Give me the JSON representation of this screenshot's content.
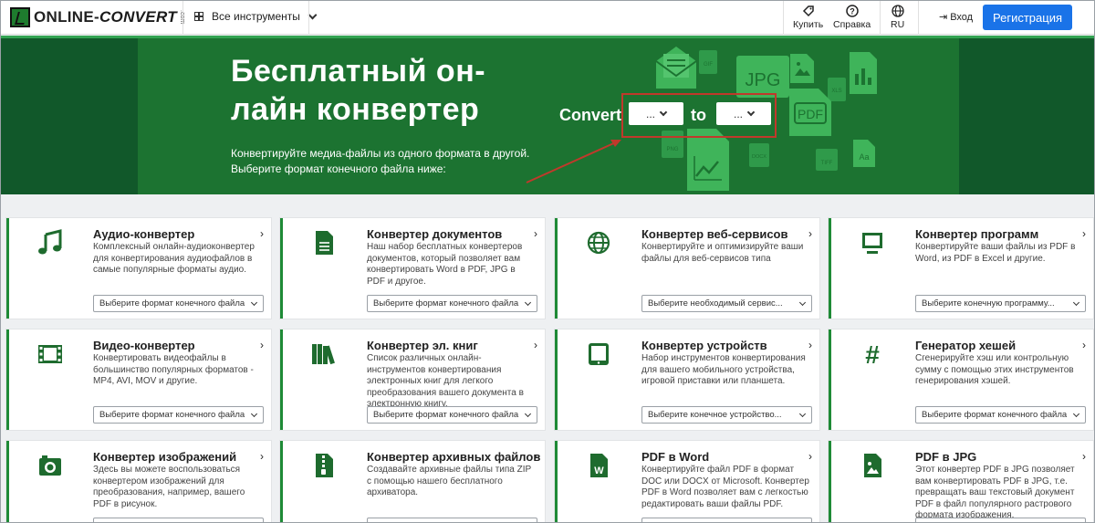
{
  "header": {
    "logo_main": "ONLINE-",
    "logo_conv": "CONVERT",
    "logo_com": ".com",
    "tools_label": "Все инструменты",
    "buy_label": "Купить",
    "help_label": "Справка",
    "lang_label": "RU",
    "login_label": "Вход",
    "register_label": "Регистрация",
    "accent_color": "#1a73e8"
  },
  "hero": {
    "title_line1": "Бесплатный он-",
    "title_line2": "лайн конвертер",
    "subtitle_line1": "Конвертируйте медиа-файлы из одного формата в другой.",
    "subtitle_line2": "Выберите формат конечного файла ниже:",
    "convert_label": "Convert",
    "to_label": "to",
    "from_value": "...",
    "to_value": "...",
    "deco_labels": [
      "JPG",
      "PDF",
      "GIF",
      "PNG",
      "XLS",
      "TIFF",
      "DOCX",
      "Aa"
    ],
    "bg_color": "#1c7331"
  },
  "cards": [
    {
      "title": "Аудио-конвертер",
      "desc": "Комплексный онлайн-аудиоконвертер для конвертирования аудиофайлов в самые популярные форматы аудио.",
      "select": "Выберите формат конечного файла",
      "icon": "music-note-icon"
    },
    {
      "title": "Конвертер документов",
      "desc": "Наш набор бесплатных конвертеров документов, который позволяет вам конвертировать Word в PDF, JPG в PDF и другое.",
      "select": "Выберите формат конечного файла",
      "icon": "document-icon"
    },
    {
      "title": "Конвертер веб-сервисов",
      "desc": "Конвертируйте и оптимизируйте ваши файлы для веб-сервисов типа",
      "select": "Выберите необходимый сервис...",
      "icon": "globe-icon"
    },
    {
      "title": "Конвертер программ",
      "desc": "Конвертируйте ваши файлы из PDF в Word, из PDF в Excel и другие.",
      "select": "Выберите конечную программу...",
      "icon": "monitor-icon"
    },
    {
      "title": "Видео-конвертер",
      "desc": "Конвертировать видеофайлы в большинство популярных форматов - MP4, AVI, MOV и другие.",
      "select": "Выберите формат конечного файла",
      "icon": "film-icon"
    },
    {
      "title": "Конвертер эл. книг",
      "desc": "Список различных онлайн-инструментов конвертирования электронных книг для легкого преобразования вашего документа в электронную книгу.",
      "select": "Выберите формат конечного файла",
      "icon": "books-icon"
    },
    {
      "title": "Конвертер устройств",
      "desc": "Набор инструментов конвертирования для вашего мобильного устройства, игровой приставки или планшета.",
      "select": "Выберите конечное устройство...",
      "icon": "tablet-icon"
    },
    {
      "title": "Генератор хешей",
      "desc": "Сгенерируйте хэш или контрольную сумму с помощью этих инструментов генерирования хэшей.",
      "select": "Выберите формат конечного файла",
      "icon": "hash-icon"
    },
    {
      "title": "Конвертер изображений",
      "desc": "Здесь вы можете воспользоваться конвертером изображений для преобразования, например, вашего PDF в рисунок.",
      "select": "",
      "icon": "camera-icon"
    },
    {
      "title": "Конвертер архивных файлов",
      "desc": "Создавайте архивные файлы типа ZIP с помощью нашего бесплатного архиватора.",
      "select": "",
      "icon": "archive-icon"
    },
    {
      "title": "PDF в Word",
      "desc": "Конвертируйте файл PDF в формат DOC или DOCX от Microsoft. Конвертер PDF в Word позволяет вам с легкостью редактировать ваши файлы PDF.",
      "select": "",
      "icon": "word-file-icon"
    },
    {
      "title": "PDF в JPG",
      "desc": "Этот конвертер PDF в JPG позволяет вам конвертировать PDF в JPG, т.е. превращать ваш текстовый документ PDF в файл популярного растрового формата изображения.",
      "select": "",
      "icon": "image-file-icon"
    }
  ]
}
